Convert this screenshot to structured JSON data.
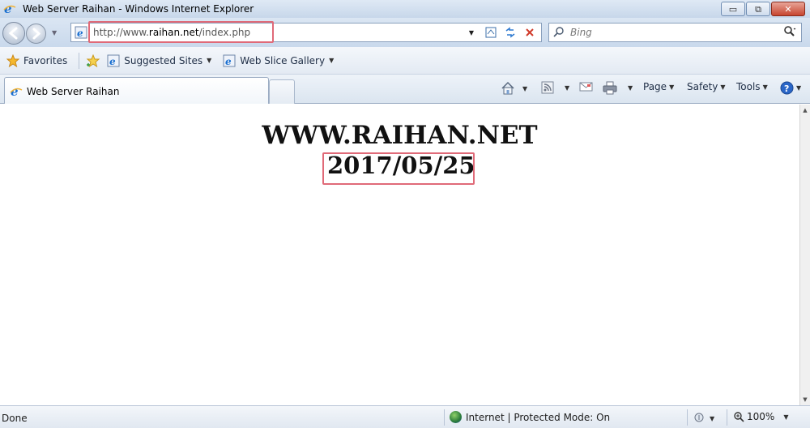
{
  "window": {
    "title": "Web Server Raihan - Windows Internet Explorer",
    "minimize_glyph": "▭",
    "restore_glyph": "⧉",
    "close_glyph": "✕"
  },
  "address_bar": {
    "url_prefix": "http://www.",
    "url_domain": "raihan.net",
    "url_path": "/index.php"
  },
  "search": {
    "placeholder": "Bing"
  },
  "favorites_bar": {
    "favorites_label": "Favorites",
    "suggested_sites_label": "Suggested Sites",
    "web_slice_gallery_label": "Web Slice Gallery"
  },
  "tabs": [
    {
      "label": "Web Server Raihan",
      "active": true
    }
  ],
  "command_bar": {
    "page_label": "Page",
    "safety_label": "Safety",
    "tools_label": "Tools"
  },
  "page": {
    "heading": "WWW.RAIHAN.NET",
    "date": "2017/05/25"
  },
  "status_bar": {
    "status_text": "Done",
    "zone_text": "Internet | Protected Mode: On",
    "zoom_text": "100%"
  },
  "colors": {
    "highlight_box": "#e06a78",
    "chrome_blue": "#c9d9ec"
  }
}
